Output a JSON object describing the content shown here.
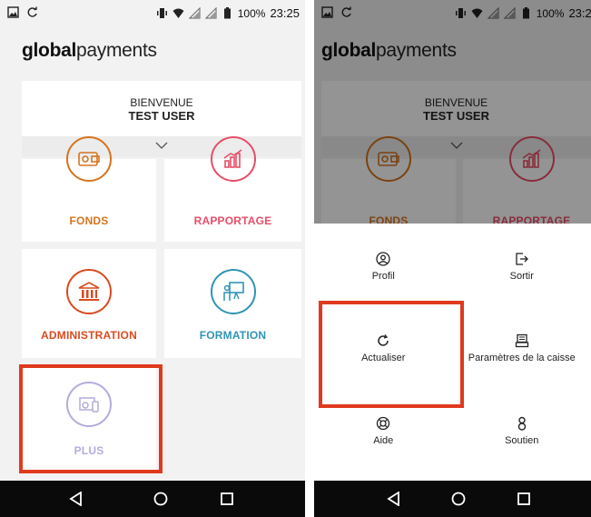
{
  "status_bar": {
    "battery": "100%",
    "time": "23:25"
  },
  "brand": {
    "bold": "global",
    "light": "payments"
  },
  "welcome": {
    "greeting": "BIENVENUE",
    "user": "TEST USER"
  },
  "tiles": {
    "fonds": "FONDS",
    "rapportage": "RAPPORTAGE",
    "administration": "ADMINISTRATION",
    "formation": "FORMATION",
    "plus": "PLUS"
  },
  "menu": {
    "profil": "Profil",
    "sortir": "Sortir",
    "actualiser": "Actualiser",
    "parametres": "Paramètres de la caisse",
    "aide": "Aide",
    "soutien": "Soutien"
  },
  "colors": {
    "fonds": "#d5741e",
    "rapportage": "#e84e67",
    "administration": "#d94a1f",
    "formation": "#2f94b4",
    "plus": "#b3acdc",
    "highlight": "#e03a1e"
  },
  "icons": [
    "image-icon",
    "sync-icon",
    "vibrate-icon",
    "wifi-icon",
    "signal-icon",
    "battery-icon",
    "wallet-gear-icon",
    "bar-chart-icon",
    "bank-building-icon",
    "presentation-board-icon",
    "devices-gear-icon",
    "user-circle-icon",
    "logout-icon",
    "refresh-icon",
    "register-icon",
    "lifebuoy-icon",
    "support-person-icon",
    "back-icon",
    "home-icon",
    "recents-icon"
  ]
}
